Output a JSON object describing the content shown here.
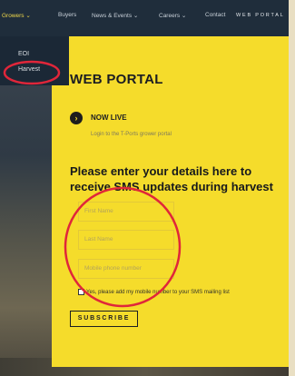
{
  "nav": {
    "items": [
      "Growers ⌄",
      "Buyers",
      "News & Events ⌄",
      "Careers ⌄",
      "Contact"
    ],
    "portal_label": "WEB PORTAL"
  },
  "dropdown": {
    "items": [
      "EOI",
      "Harvest"
    ]
  },
  "panel": {
    "title": "WEB PORTAL",
    "live_label": "NOW LIVE",
    "live_sub": "Login to the T-Ports grower portal",
    "heading": "Please enter your details here to receive SMS updates during harvest"
  },
  "form": {
    "first_name_placeholder": "First Name",
    "last_name_placeholder": "Last Name",
    "mobile_placeholder": "Mobile phone number",
    "consent_text": "Yes, please add my mobile number to your SMS mailing list",
    "subscribe_label": "SUBSCRIBE"
  },
  "colors": {
    "panel": "#f5dc2b",
    "nav": "#1f2d3b",
    "annotation": "#e0263a"
  }
}
